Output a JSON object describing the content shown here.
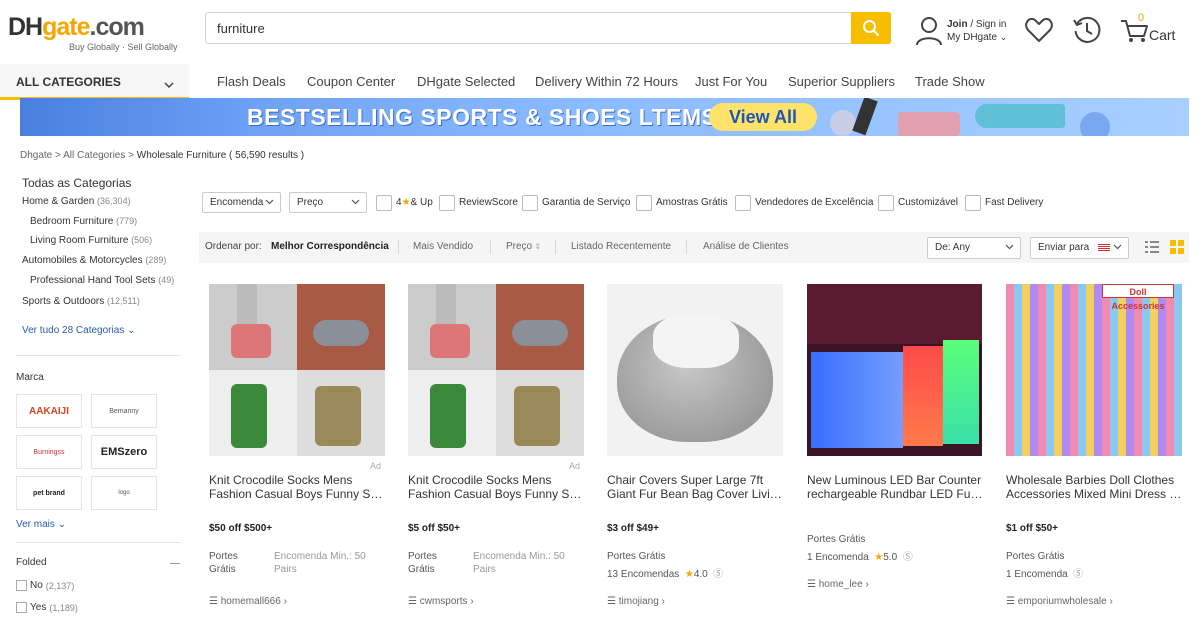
{
  "header": {
    "logo_main_a": "DH",
    "logo_main_b": "gate",
    "logo_main_c": ".com",
    "logo_sub": "Buy Globally · Sell Globally",
    "search_value": "furniture",
    "join": "Join",
    "sign_in": " / Sign in",
    "my_dhgate": "My DHgate",
    "cart_count": "0",
    "cart_label": "Cart"
  },
  "nav": {
    "all_categories": "ALL CATEGORIES",
    "items": [
      "Flash Deals",
      "Coupon Center",
      "DHgate Selected",
      "Delivery Within 72 Hours",
      "Just For You",
      "Superior Suppliers",
      "Trade Show"
    ]
  },
  "banner": {
    "text": "BESTSELLING SPORTS & SHOES LTEMS",
    "button": "View All"
  },
  "breadcrumb": {
    "home": "Dhgate",
    "sep": " > ",
    "all": "All Categories",
    "current": "Wholesale Furniture",
    "results": " ( 56,590  results )"
  },
  "sidebar": {
    "title": "Todas as Categorias",
    "categories": [
      {
        "label": "Home & Garden",
        "count": "(36,304)"
      },
      {
        "label": "Bedroom Furniture",
        "count": "(779)"
      },
      {
        "label": "Living Room Furniture",
        "count": "(506)"
      },
      {
        "label": "Automobiles & Motorcycles",
        "count": "(289)"
      },
      {
        "label": "Professional Hand Tool Sets",
        "count": "(49)"
      },
      {
        "label": "Sports & Outdoors",
        "count": "(12,511)"
      }
    ],
    "see_all": "Ver tudo 28 Categorias",
    "brand_title": "Marca",
    "brands": [
      "AAKAIJI",
      "Bemanny",
      "Burningss",
      "EMSzero",
      "pet brand",
      "logo"
    ],
    "see_more": "Ver mais",
    "folded_title": "Folded",
    "folded_options": [
      {
        "label": "No",
        "count": "(2,137)"
      },
      {
        "label": "Yes",
        "count": "(1,189)"
      }
    ]
  },
  "filters": {
    "encomenda": "Encomenda",
    "preco": "Preço",
    "stars": "4",
    "stars_suffix": "& Up",
    "checks": [
      "ReviewScore",
      "Garantia de Serviço",
      "Amostras Grátis",
      "Vendedores de Excelência",
      "Customizável",
      "Fast Delivery"
    ]
  },
  "sort": {
    "label": "Ordenar por:",
    "options": [
      "Melhor Correspondência",
      "Mais Vendido",
      "Preço",
      "Listado Recentemente",
      "Análise de Clientes"
    ],
    "de_label": "De:",
    "de_value": "Any",
    "ship_to": "Enviar para"
  },
  "products": [
    {
      "ad": "Ad",
      "title1": "Knit Crocodile Socks Mens",
      "title2": "Fashion Casual Boys Funny Shark Socks",
      "price": "$50 off $500+",
      "ship1": "Portes",
      "ship2": "Grátis",
      "min1": "Encomenda Min.: 50",
      "min2": "Pairs",
      "store": "homemall666"
    },
    {
      "ad": "Ad",
      "title1": "Knit Crocodile Socks Mens",
      "title2": "Fashion Casual Boys Funny Shark Socks",
      "price": "$5 off $50+",
      "ship1": "Portes",
      "ship2": "Grátis",
      "min1": "Encomenda Min.: 50",
      "min2": "Pairs",
      "store": "cwmsports"
    },
    {
      "title1": "Chair Covers Super Large 7ft",
      "title2": "Giant Fur Bean Bag Cover Living Room",
      "price": "$3 off $49+",
      "ship": "Portes Grátis",
      "orders": "13 Encomendas",
      "rating": "4.0",
      "store": "timojiang"
    },
    {
      "title1": "New Luminous LED Bar Counter",
      "title2": "rechargeable Rundbar LED Furniture",
      "ship": "Portes Grátis",
      "orders": "1 Encomenda",
      "rating": "5.0",
      "store": "home_lee"
    },
    {
      "title1": "Wholesale Barbies Doll Clothes",
      "title2": "Accessories Mixed Mini Dress Up Toys",
      "price": "$1 off $50+",
      "ship": "Portes Grátis",
      "orders": "1 Encomenda",
      "store": "emporiumwholesale",
      "img_label": "Doll Accessories"
    }
  ],
  "colors": {
    "accent": "#f7bd00",
    "brand_orange": "#f7a500",
    "link": "#2a5ab0"
  }
}
